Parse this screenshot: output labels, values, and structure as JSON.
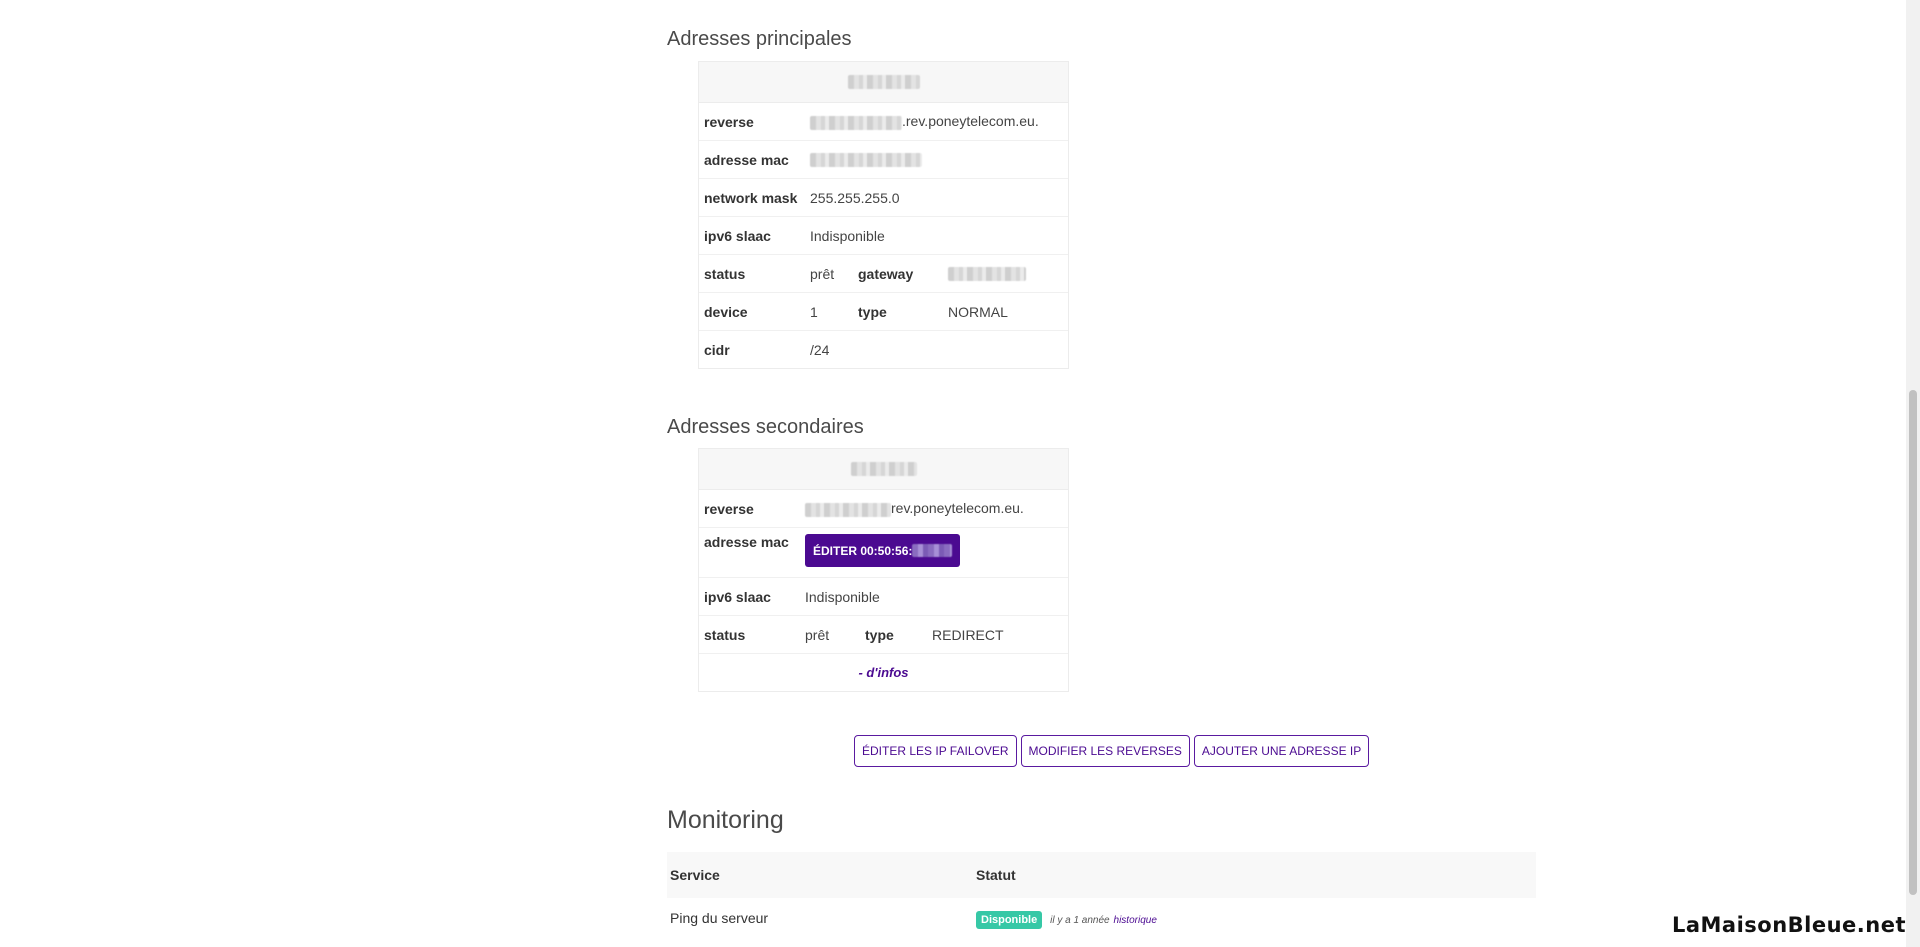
{
  "primary": {
    "title": "Adresses principales",
    "reverse_suffix": ".rev.poneytelecom.eu.",
    "rows": {
      "reverse_label": "reverse",
      "mac_label": "adresse mac",
      "mask_label": "network mask",
      "mask_value": "255.255.255.0",
      "slaac_label": "ipv6 slaac",
      "slaac_value": "Indisponible",
      "status_label": "status",
      "status_value": "prêt",
      "gateway_label": "gateway",
      "device_label": "device",
      "device_value": "1",
      "type_label": "type",
      "type_value": "NORMAL",
      "cidr_label": "cidr",
      "cidr_value": "/24"
    }
  },
  "secondary": {
    "title": "Adresses secondaires",
    "reverse_label": "reverse",
    "reverse_suffix": "rev.poneytelecom.eu.",
    "mac_label": "adresse mac",
    "mac_button": "ÉDITER 00:50:56:",
    "slaac_label": "ipv6 slaac",
    "slaac_value": "Indisponible",
    "status_label": "status",
    "status_value": "prêt",
    "type_label": "type",
    "type_value": "REDIRECT",
    "less_info": "- d'infos"
  },
  "actions": {
    "edit_failover": "ÉDITER LES IP FAILOVER",
    "edit_reverses": "MODIFIER LES REVERSES",
    "add_ip": "AJOUTER UNE ADRESSE IP"
  },
  "monitoring": {
    "title": "Monitoring",
    "col_service": "Service",
    "col_status": "Statut",
    "rows": [
      {
        "service": "Ping du serveur",
        "status": "Disponible",
        "since": "il y a 1 année",
        "history": "historique"
      }
    ]
  },
  "watermark": "LaMaisonBleue.net",
  "colors": {
    "accent": "#4b0a91",
    "available": "#36c8a6"
  }
}
